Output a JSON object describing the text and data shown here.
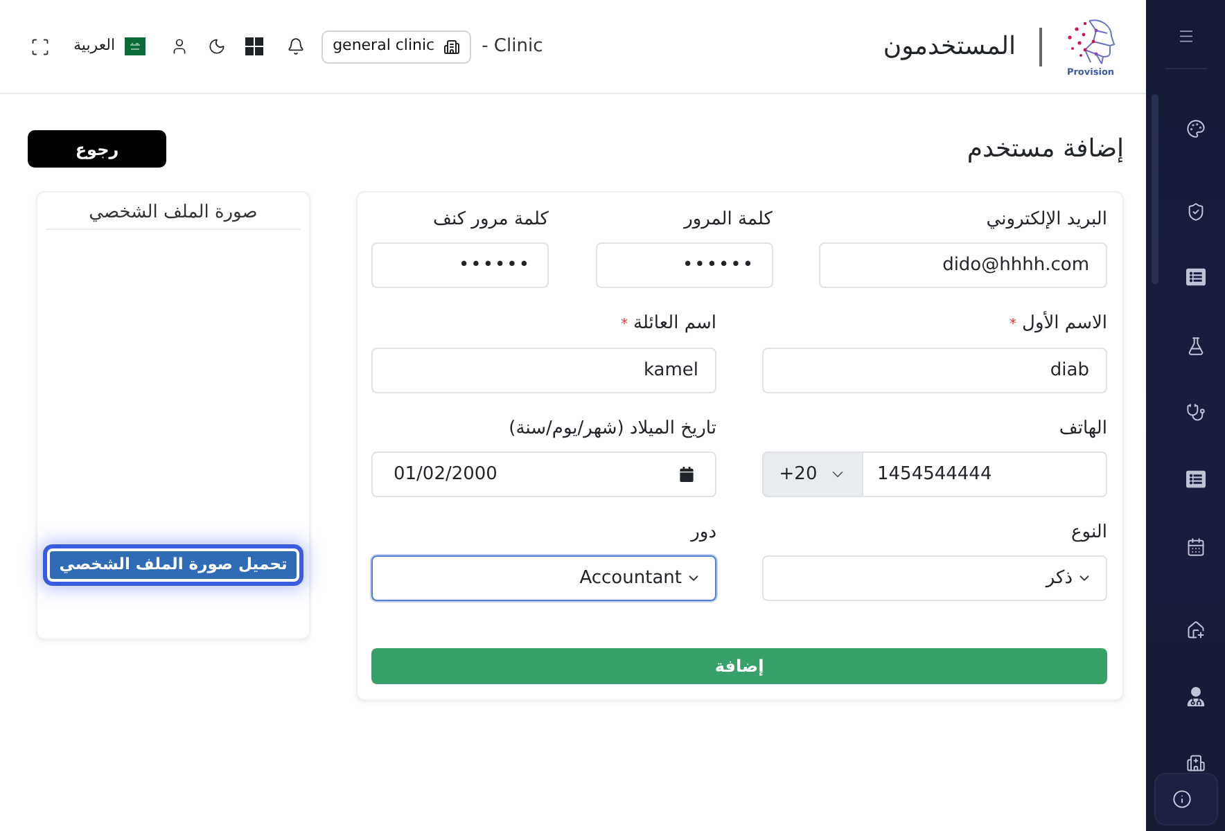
{
  "header": {
    "clinic_suffix": "- Clinic",
    "clinic_selector": "general clinic",
    "language": "العربية",
    "page_title": "المستخدمون",
    "logo_text": "Provision"
  },
  "page": {
    "title": "إضافة مستخدم",
    "back_button": "رجوع"
  },
  "profile_card": {
    "title": "صورة الملف الشخصي",
    "upload_button": {
      "label": "تحميل صورة الملف الشخصي",
      "focused": true
    }
  },
  "form": {
    "rows": [
      [
        {
          "kind": "text",
          "label": "البريد الإلكتروني",
          "value": "dido@hhhh.com"
        },
        {
          "kind": "password",
          "label": "كلمة المرور",
          "value": "••••••"
        },
        {
          "kind": "password",
          "label": "كلمة مرور كنف",
          "value": "••••••"
        }
      ],
      [
        {
          "kind": "text",
          "label": "الاسم الأول",
          "required_mark": "*",
          "value": "diab"
        },
        {
          "kind": "text",
          "label": "اسم العائلة",
          "required_mark": "*",
          "value": "kamel"
        }
      ],
      [
        {
          "kind": "phone",
          "label": "الهاتف",
          "prefix": "+20",
          "value": "1454544444"
        },
        {
          "kind": "date",
          "label": "تاريخ الميلاد (شهر/يوم/سنة)",
          "value": "01/02/2000"
        }
      ],
      [
        {
          "kind": "select",
          "label": "النوع",
          "value": "ذكر",
          "focused": false
        },
        {
          "kind": "select",
          "label": "دور",
          "value": "Accountant",
          "focused": true
        }
      ]
    ],
    "submit_button": "إضافة"
  }
}
